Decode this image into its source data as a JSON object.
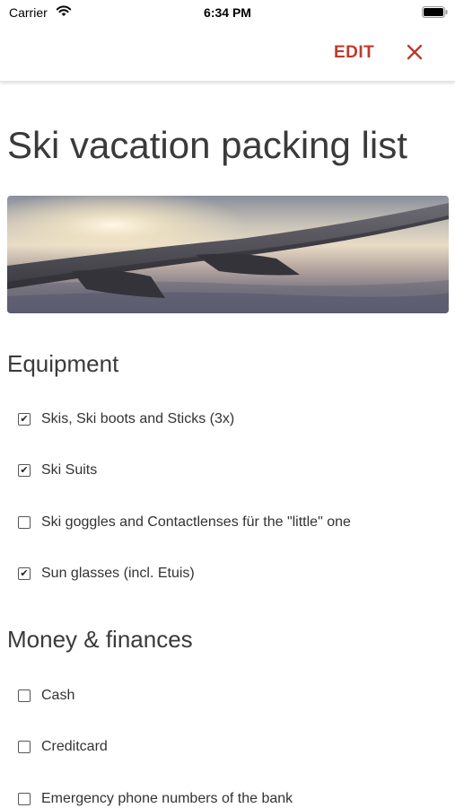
{
  "status_bar": {
    "carrier": "Carrier",
    "time": "6:34 PM"
  },
  "nav": {
    "edit_label": "EDIT",
    "close_icon": "close-icon"
  },
  "accent_color": "#c0392b",
  "title": "Ski vacation packing list",
  "cover_image": {
    "subject": "airplane wing above clouds at sunset"
  },
  "sections": [
    {
      "heading": "Equipment",
      "items": [
        {
          "label": "Skis, Ski boots and Sticks (3x)",
          "checked": true
        },
        {
          "label": "Ski Suits",
          "checked": true
        },
        {
          "label": "Ski goggles and Contactlenses für the \"little\" one",
          "checked": false
        },
        {
          "label": "Sun glasses (incl. Etuis)",
          "checked": true
        }
      ]
    },
    {
      "heading": "Money & finances",
      "items": [
        {
          "label": "Cash",
          "checked": false
        },
        {
          "label": "Creditcard",
          "checked": false
        },
        {
          "label": "Emergency phone numbers of the bank",
          "checked": false
        }
      ]
    }
  ]
}
